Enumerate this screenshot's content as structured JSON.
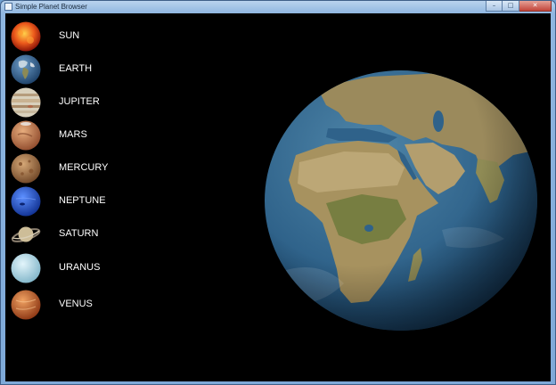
{
  "window": {
    "title": "Simple Planet Browser"
  },
  "caption_buttons": {
    "minimize": "–",
    "maximize": "□",
    "close": "✕"
  },
  "planets": [
    {
      "name": "SUN",
      "icon": "sun-icon",
      "color": "#e14a1c"
    },
    {
      "name": "EARTH",
      "icon": "earth-icon",
      "color": "#3d6f9e"
    },
    {
      "name": "JUPITER",
      "icon": "jupiter-icon",
      "color": "#c9bfa8"
    },
    {
      "name": "MARS",
      "icon": "mars-icon",
      "color": "#c77a52"
    },
    {
      "name": "MERCURY",
      "icon": "mercury-icon",
      "color": "#a6754a"
    },
    {
      "name": "NEPTUNE",
      "icon": "neptune-icon",
      "color": "#2a5fcf"
    },
    {
      "name": "SATURN",
      "icon": "saturn-icon",
      "color": "#bfae8a"
    },
    {
      "name": "URANUS",
      "icon": "uranus-icon",
      "color": "#b5dbe9"
    },
    {
      "name": "VENUS",
      "icon": "venus-icon",
      "color": "#c9612c"
    }
  ],
  "viewer": {
    "selected_planet": "EARTH"
  },
  "colors": {
    "background": "#000000",
    "label": "#ffffff",
    "ocean": "#2c5f87",
    "land": "#9b8a5c"
  }
}
